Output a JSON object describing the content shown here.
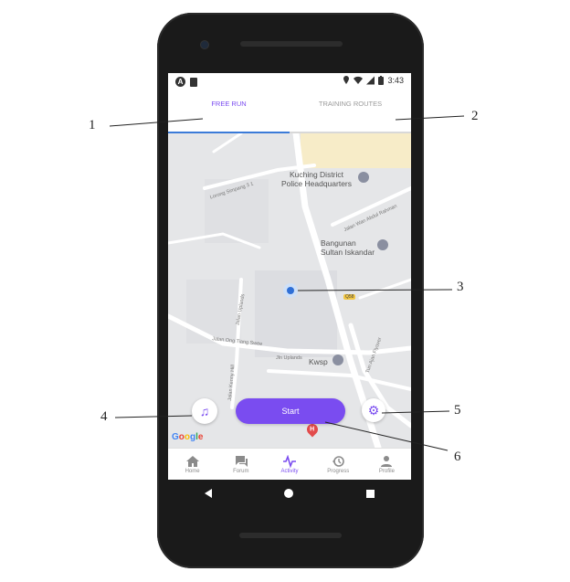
{
  "status_bar": {
    "time": "3:43",
    "left_badge": "A"
  },
  "tabs": [
    {
      "label": "FREE RUN",
      "active": true
    },
    {
      "label": "TRAINING ROUTES",
      "active": false
    }
  ],
  "map": {
    "places": {
      "police": "Kuching District\nPolice Headquarters",
      "bangunan": "Bangunan\nSultan Iskandar",
      "kwsp": "Kwsp"
    },
    "roads": {
      "lorong_simpang": "Lorong Simpang 3 1",
      "jalan_wan_abdul": "Jalan Wan Abdul Rahman",
      "jalan_uplands": "Jalan Uplands",
      "jalan_ong_tiang_swee": "Jalan Ong Tiang Swee",
      "jln_uplands": "Jln Uplands",
      "jalan_kenny_hill": "Jalan Kenny Hill",
      "tun_ahmad_flyover": "Tun Ajan Flyover",
      "route_badge": "Q58"
    },
    "hospital_letter": "H",
    "attribution": {
      "G": "G",
      "o1": "o",
      "o2": "o",
      "g": "g",
      "l": "l",
      "e": "e"
    },
    "colors": {
      "g_blue": "#4285F4",
      "g_red": "#EA4335",
      "g_yellow": "#FBBC05",
      "g_green": "#34A853"
    }
  },
  "controls": {
    "start_label": "Start",
    "music_icon": "music-note-icon",
    "settings_icon": "gear-icon"
  },
  "bottom_nav": [
    {
      "label": "Home",
      "icon": "home-icon",
      "active": false
    },
    {
      "label": "Forum",
      "icon": "forum-icon",
      "active": false
    },
    {
      "label": "Activity",
      "icon": "activity-icon",
      "active": true
    },
    {
      "label": "Progress",
      "icon": "history-icon",
      "active": false
    },
    {
      "label": "Profile",
      "icon": "profile-icon",
      "active": false
    }
  ],
  "callouts": [
    "1",
    "2",
    "3",
    "4",
    "5",
    "6"
  ],
  "accent_color": "#7a4cf0"
}
